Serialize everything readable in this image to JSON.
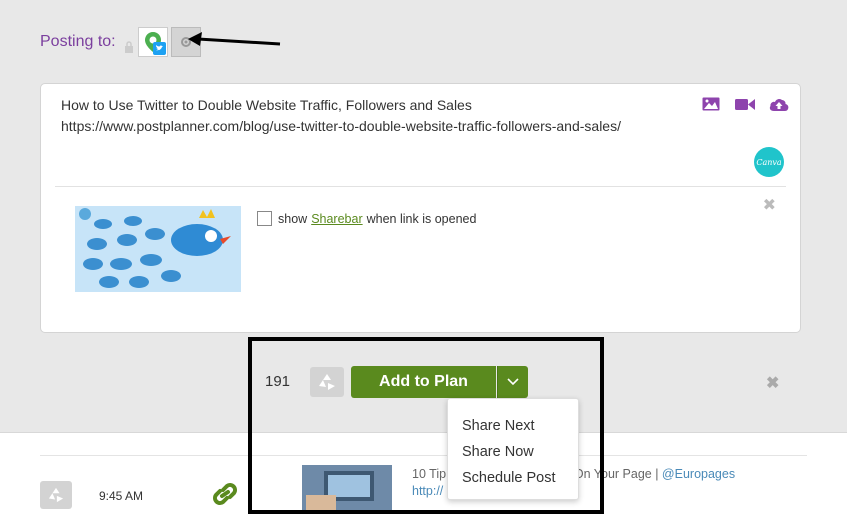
{
  "header": {
    "posting_label": "Posting to:"
  },
  "composer": {
    "post_title_line": "How to Use Twitter to Double Website Traffic, Followers and Sales",
    "post_url_line": "https://www.postplanner.com/blog/use-twitter-to-double-website-traffic-followers-and-sales/",
    "canva_label": "Canva",
    "sharebar": {
      "prefix": "show",
      "link_text": "Sharebar",
      "suffix": "when link is opened",
      "checked": false
    },
    "icons": [
      "image-icon",
      "video-icon",
      "upload-cloud-icon"
    ],
    "close_glyph": "✖"
  },
  "actions": {
    "character_count": "191",
    "add_to_plan_label": "Add to Plan",
    "close_glyph": "✖"
  },
  "dropdown_menu": {
    "items": [
      "Share Next",
      "Share Now",
      "Schedule Post"
    ]
  },
  "scheduled_post": {
    "time": "9:45 AM",
    "title_left": "10 Tip",
    "title_right": "ok Sales On Your Page | ",
    "source": "@Europages",
    "url": "http://"
  },
  "colors": {
    "purple": "#7b3f9e",
    "green": "#5a8a1e",
    "twitter_blue": "#1da1f2",
    "canva_teal": "#20c4cb"
  }
}
